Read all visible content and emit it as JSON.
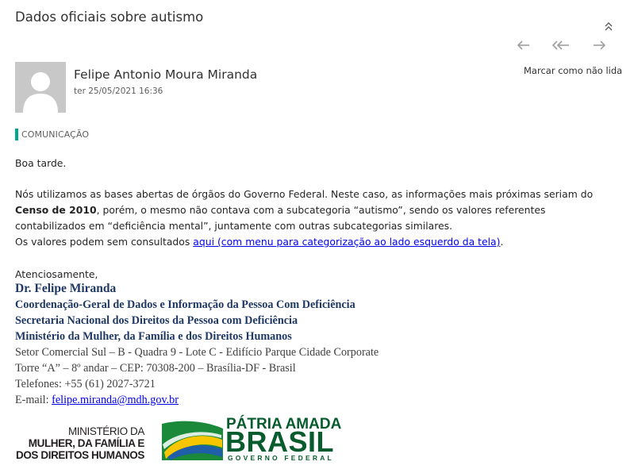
{
  "email": {
    "subject": "Dados oficiais sobre autismo",
    "mark_unread_label": "Marcar como não lida",
    "sender_name": "Felipe Antonio Moura Miranda",
    "date": "ter 25/05/2021 16:36",
    "category_tag": "COMUNICAÇÃO",
    "accent_color": "#00a88f"
  },
  "icons": {
    "collapse": "double-chevron-up-icon",
    "reply": "reply-arrow-icon",
    "reply_all": "reply-all-arrow-icon",
    "forward": "forward-arrow-icon",
    "avatar": "default-person-avatar"
  },
  "body": {
    "greeting": "Boa tarde.",
    "p1_part1": "Nós utilizamos as bases abertas de órgãos do Governo Federal. Neste caso, as informações mais próximas seriam do ",
    "p1_bold": "Censo de 2010",
    "p1_part2": ", porém, o mesmo não contava com a subcategoria “autismo”, sendo os valores referentes contabilizados em “deficiência mental”, juntamente com outras subcategorias similares.",
    "p2_prefix": "Os valores podem sem consultados ",
    "p2_link": "aqui (com menu para categorização ao lado esquerdo da tela)",
    "p2_suffix": ".",
    "closing": "Atenciosamente,"
  },
  "signature": {
    "name": "Dr. Felipe Miranda",
    "line1": "Coordenação-Geral de Dados e Informação da Pessoa Com Deficiência",
    "line2": "Secretaria Nacional dos Direitos da Pessoa com Deficiência",
    "line3": "Ministério da Mulher, da Família e dos Direitos Humanos",
    "address1": "Setor Comercial Sul – B - Quadra 9 - Lote C - Edifício Parque Cidade Corporate",
    "address2": "Torre “A” – 8º andar – CEP: 70308-200 – Brasília-DF - Brasil",
    "phone": "Telefones: +55 (61) 2027-3721",
    "email_prefix": "E-mail: ",
    "email": "felipe.miranda@mdh.gov.br"
  },
  "logos": {
    "ministry_line1": "MINISTÉRIO DA",
    "ministry_line2": "MULHER, DA FAMÍLIA E",
    "ministry_line3": "DOS DIREITOS HUMANOS",
    "brand_line1": "PÁTRIA AMADA",
    "brand_line2": "BRASIL",
    "brand_line3": "GOVERNO FEDERAL",
    "brand_green": "#075b2c",
    "brand_yellow": "#f7c600",
    "brand_blue": "#1f5fa8"
  }
}
